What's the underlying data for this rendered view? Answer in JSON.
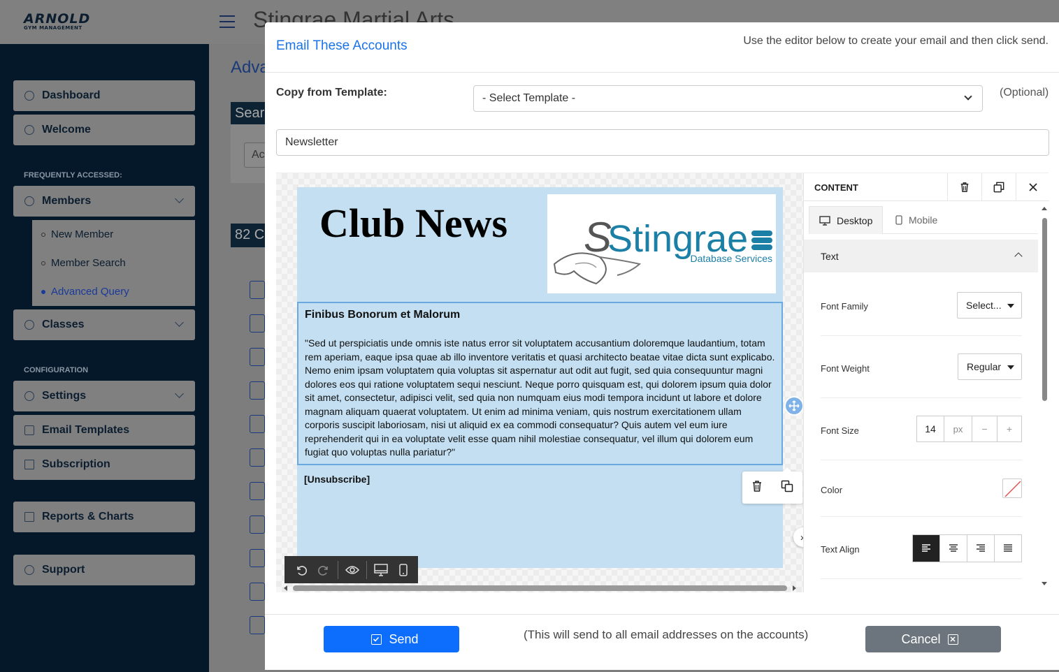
{
  "app": {
    "logo_line1": "ARNOLD",
    "logo_line2": "GYM MANAGEMENT",
    "page_header": "Stingrae Martial Arts",
    "bg_title": "Adva",
    "bg_search": "Searc",
    "bg_input": "Ac",
    "bg_count": "82 C"
  },
  "sidebar": {
    "items": [
      {
        "label": "Dashboard",
        "icon": "dashboard-icon"
      },
      {
        "label": "Welcome",
        "icon": "home-icon"
      }
    ],
    "section_frequent": "FREQUENTLY ACCESSED:",
    "members": {
      "label": "Members",
      "icon": "members-icon"
    },
    "members_sub": [
      {
        "label": "New Member"
      },
      {
        "label": "Member Search"
      },
      {
        "label": "Advanced Query"
      }
    ],
    "classes": {
      "label": "Classes",
      "icon": "classes-icon"
    },
    "section_config": "CONFIGURATION",
    "settings": {
      "label": "Settings",
      "icon": "gear-icon"
    },
    "email_templates": {
      "label": "Email Templates",
      "icon": "email-icon"
    },
    "subscription": {
      "label": "Subscription",
      "icon": "building-icon"
    },
    "reports": {
      "label": "Reports & Charts",
      "icon": "chart-icon"
    },
    "support": {
      "label": "Support",
      "icon": "help-icon"
    }
  },
  "modal": {
    "title": "Email These Accounts",
    "hint": "Use the editor below to create your email and then click send.",
    "template_label": "Copy from Template:",
    "template_select": "- Select Template -",
    "optional": "(Optional)",
    "subject": "Newsletter",
    "send_label": "Send",
    "send_note": "(This will send to all email addresses on the accounts)",
    "cancel_label": "Cancel"
  },
  "email": {
    "header_title": "Club News",
    "logo_text": "Stingrae",
    "logo_subtext": "Database Services",
    "heading": "Finibus Bonorum et Malorum",
    "body": "\"Sed ut perspiciatis unde omnis iste natus error sit voluptatem accusantium doloremque laudantium, totam rem aperiam, eaque ipsa quae ab illo inventore veritatis et quasi architecto beatae vitae dicta sunt explicabo. Nemo enim ipsam voluptatem quia voluptas sit aspernatur aut odit aut fugit, sed quia consequuntur magni dolores eos qui ratione voluptatem sequi nesciunt. Neque porro quisquam est, qui dolorem ipsum quia dolor sit amet, consectetur, adipisci velit, sed quia non numquam eius modi tempora incidunt ut labore et dolore magnam aliquam quaerat voluptatem. Ut enim ad minima veniam, quis nostrum exercitationem ullam corporis suscipit laboriosam, nisi ut aliquid ex ea commodi consequatur? Quis autem vel eum iure reprehenderit qui in ea voluptate velit esse quam nihil molestiae consequatur, vel illum qui dolorem eum fugiat quo voluptas nulla pariatur?\"",
    "unsubscribe": "[Unsubscribe]"
  },
  "panel": {
    "header": "CONTENT",
    "tabs": [
      {
        "label": "Desktop"
      },
      {
        "label": "Mobile"
      }
    ],
    "active_tab": "Desktop",
    "section": "Text",
    "font_family_label": "Font Family",
    "font_family_value": "Select...",
    "font_weight_label": "Font Weight",
    "font_weight_value": "Regular",
    "font_size_label": "Font Size",
    "font_size_value": "14",
    "font_size_unit": "px",
    "font_size_minus": "−",
    "font_size_plus": "+",
    "color_label": "Color",
    "text_align_label": "Text Align",
    "text_align_value": "left"
  },
  "colors": {
    "primary": "#0d6efd",
    "cancel": "#6c757d",
    "sidebar_bg": "#05182a",
    "email_bg": "#c3dff1",
    "title_blue": "#1a73e8",
    "logo_teal": "#1b7fa6"
  }
}
